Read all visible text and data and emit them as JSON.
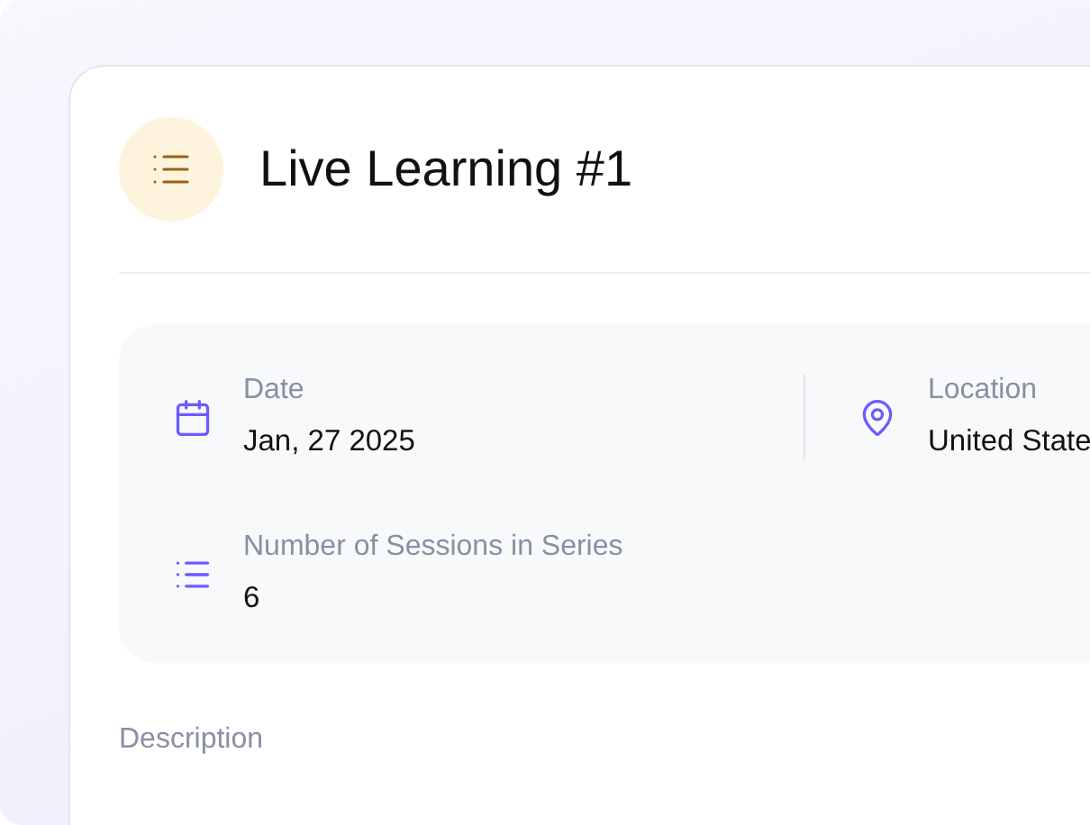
{
  "header": {
    "title": "Live Learning #1"
  },
  "details": [
    {
      "kind": "calendar",
      "label": "Date",
      "value": "Jan, 27 2025"
    },
    {
      "kind": "location",
      "label": "Location",
      "value": "United State"
    },
    {
      "kind": "list",
      "label": "Number of Sessions in Series",
      "value": "6"
    }
  ],
  "description": {
    "label": "Description"
  }
}
